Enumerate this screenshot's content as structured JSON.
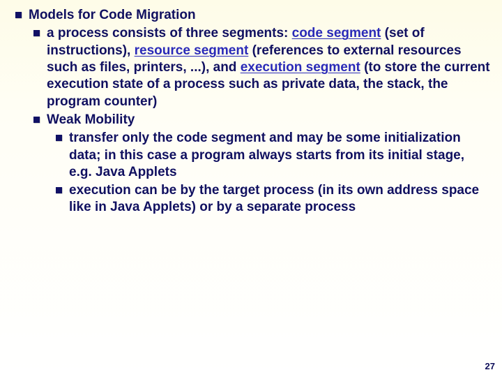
{
  "slide": {
    "title": "Models for Code Migration",
    "point1_pre": "a process consists of three segments: ",
    "term_code": "code segment",
    "point1_mid1": " (set of instructions), ",
    "term_resource": "resource segment",
    "point1_mid2": " (references to external resources such as files, printers, ...), and ",
    "term_exec": "execution segment",
    "point1_post": " (to store the current execution state of a process such as private data, the stack, the program counter)",
    "weak_mobility": "Weak Mobility",
    "wm_sub1": "transfer only the code segment and may be some initialization data; in this case a program always starts from its initial stage, e.g. Java Applets",
    "wm_sub2": "execution can be by the target process (in its own address space like in Java Applets) or by a separate process",
    "page_number": "27"
  }
}
